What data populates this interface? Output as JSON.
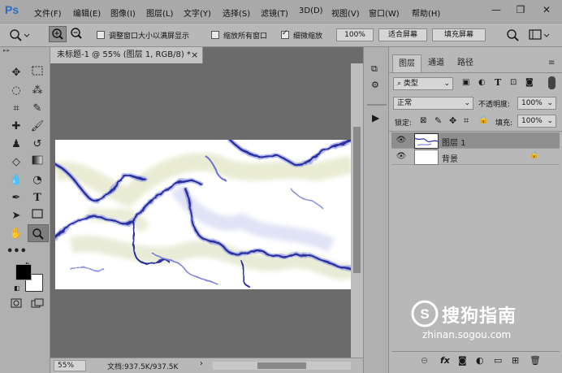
{
  "app": {
    "logo": "Ps"
  },
  "menu": [
    "文件(F)",
    "编辑(E)",
    "图像(I)",
    "图层(L)",
    "文字(Y)",
    "选择(S)",
    "滤镜(T)",
    "3D(D)",
    "视图(V)",
    "窗口(W)",
    "帮助(H)"
  ],
  "window_controls": {
    "minimize": "—",
    "restore": "❐",
    "close": "✕"
  },
  "options": {
    "resize_windows": "调整窗口大小以满屏显示",
    "zoom_all_windows": "缩放所有窗口",
    "scrubby_zoom": "细微缩放",
    "zoom_value": "100%",
    "fit_screen": "适合屏幕",
    "fill_screen": "填充屏幕"
  },
  "document": {
    "tab_title": "未标题-1 @ 55% (图层 1, RGB/8) *",
    "tab_close": "×",
    "status_zoom": "55%",
    "status_doc": "文档:937.5K/937.5K"
  },
  "layers_panel": {
    "tabs": [
      "图层",
      "通道",
      "路径"
    ],
    "filter_label": "类型",
    "blend_mode": "正常",
    "opacity_label": "不透明度:",
    "opacity_value": "100%",
    "lock_label": "锁定:",
    "fill_label": "填充:",
    "fill_value": "100%",
    "layers": [
      {
        "name": "图层 1",
        "selected": true
      },
      {
        "name": "背景",
        "locked": true
      }
    ],
    "bottom_icons": [
      "link-icon",
      "fx-icon",
      "mask-icon",
      "adjustment-icon",
      "group-icon",
      "new-layer-icon",
      "trash-icon"
    ],
    "fx_text": "fx"
  },
  "watermark": {
    "brand": "搜狗指南",
    "url": "zhinan.sogou.com"
  },
  "colors": {
    "menubar": "#a9a9a9",
    "panel": "#b8b8b8",
    "workspace": "#6b6b6b",
    "accent": "#2b6cc4",
    "stroke_blue": "#2a2f9e"
  }
}
